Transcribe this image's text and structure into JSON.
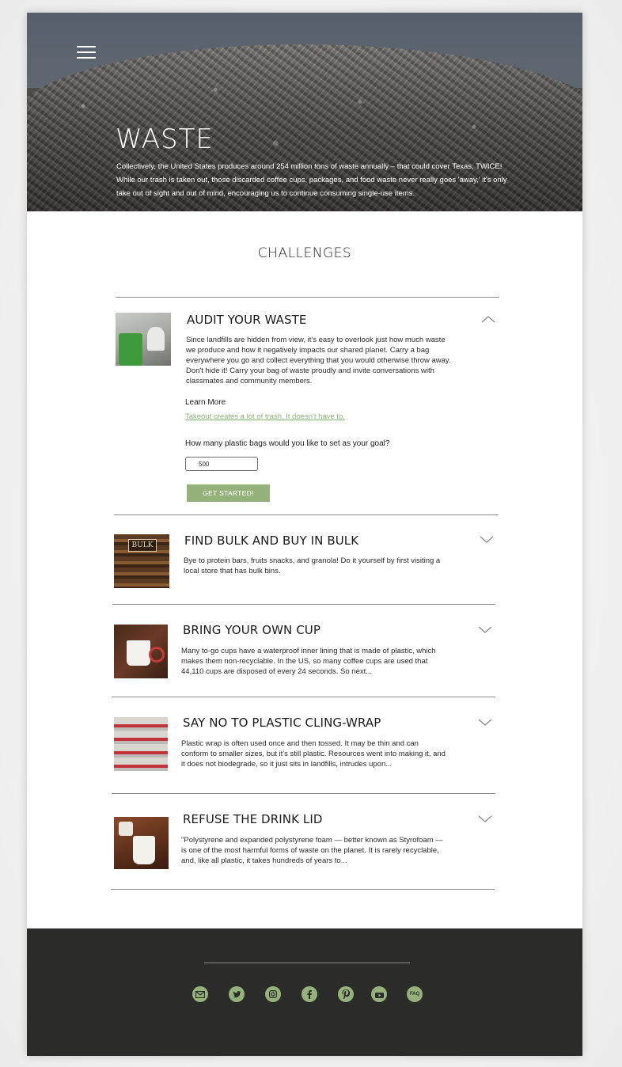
{
  "hero": {
    "menu_icon": "hamburger-menu-icon",
    "title": "WASTE",
    "text": "Collectively, the United States produces around 254 million tons of waste annually – that could cover Texas, TWICE! While our trash is taken out, those discarded coffee cups, packages, and food waste never really goes 'away,' it's only take out of sight and out of mind, encouraging us to continue consuming single-use items."
  },
  "challenges_heading": "CHALLENGES",
  "challenges": [
    {
      "title": "AUDIT YOUR WASTE",
      "description": "Since landfills are hidden from view, it's easy to overlook just how much waste we produce and how it negatively impacts our shared planet. Carry a bag everywhere you go and collect everything that you would otherwise throw away. Don't hide it! Carry your bag of waste proudly and invite conversations with classmates and community members.",
      "expanded": true,
      "chevron_icon": "chevron-up-icon",
      "learn_more_label": "Learn More",
      "learn_more_link": "Takeout creates a lot of trash. It doesn't have to.",
      "goal_question": "How many plastic bags would you like to set as your goal?",
      "goal_value": "500",
      "cta_label": "GET STARTED!"
    },
    {
      "title": "FIND BULK AND BUY IN BULK",
      "description": "Bye to protein bars, fruits snacks, and granola! Do it yourself by first visiting a local store that has bulk bins.",
      "expanded": false,
      "chevron_icon": "chevron-down-icon",
      "thumb_text": "BULK"
    },
    {
      "title": "BRING YOUR OWN CUP",
      "description": "Many to-go cups have a waterproof inner lining that is made of plastic, which makes them non-recyclable. In the US, so many coffee cups are used that 44,110 cups are disposed of every 24 seconds. So next...",
      "expanded": false,
      "chevron_icon": "chevron-down-icon"
    },
    {
      "title": "SAY NO TO PLASTIC CLING-WRAP",
      "description": "Plastic wrap is often used once and then tossed. It may be thin and can conform to smaller sizes, but it's still plastic. Resources went into making it, and it does not biodegrade, so it just sits in landfills, intrudes upon...",
      "expanded": false,
      "chevron_icon": "chevron-down-icon"
    },
    {
      "title": "REFUSE THE DRINK LID",
      "description": "\"Polystyrene and expanded polystyrene foam — better known as Styrofoam — is one of the most harmful forms of waste on the planet. It is rarely recyclable, and, like all plastic, it takes hundreds of years to...",
      "expanded": false,
      "chevron_icon": "chevron-down-icon"
    }
  ],
  "footer": {
    "social_icons": [
      "email-icon",
      "twitter-icon",
      "instagram-icon",
      "facebook-icon",
      "pinterest-icon",
      "youtube-icon",
      "faq-icon"
    ],
    "faq_label": "FAQ",
    "accent_color": "#95b27c",
    "background_color": "#2b2b2a"
  },
  "colors": {
    "accent": "#95b27c",
    "link": "#8db07a",
    "text": "#1e1e1e"
  }
}
